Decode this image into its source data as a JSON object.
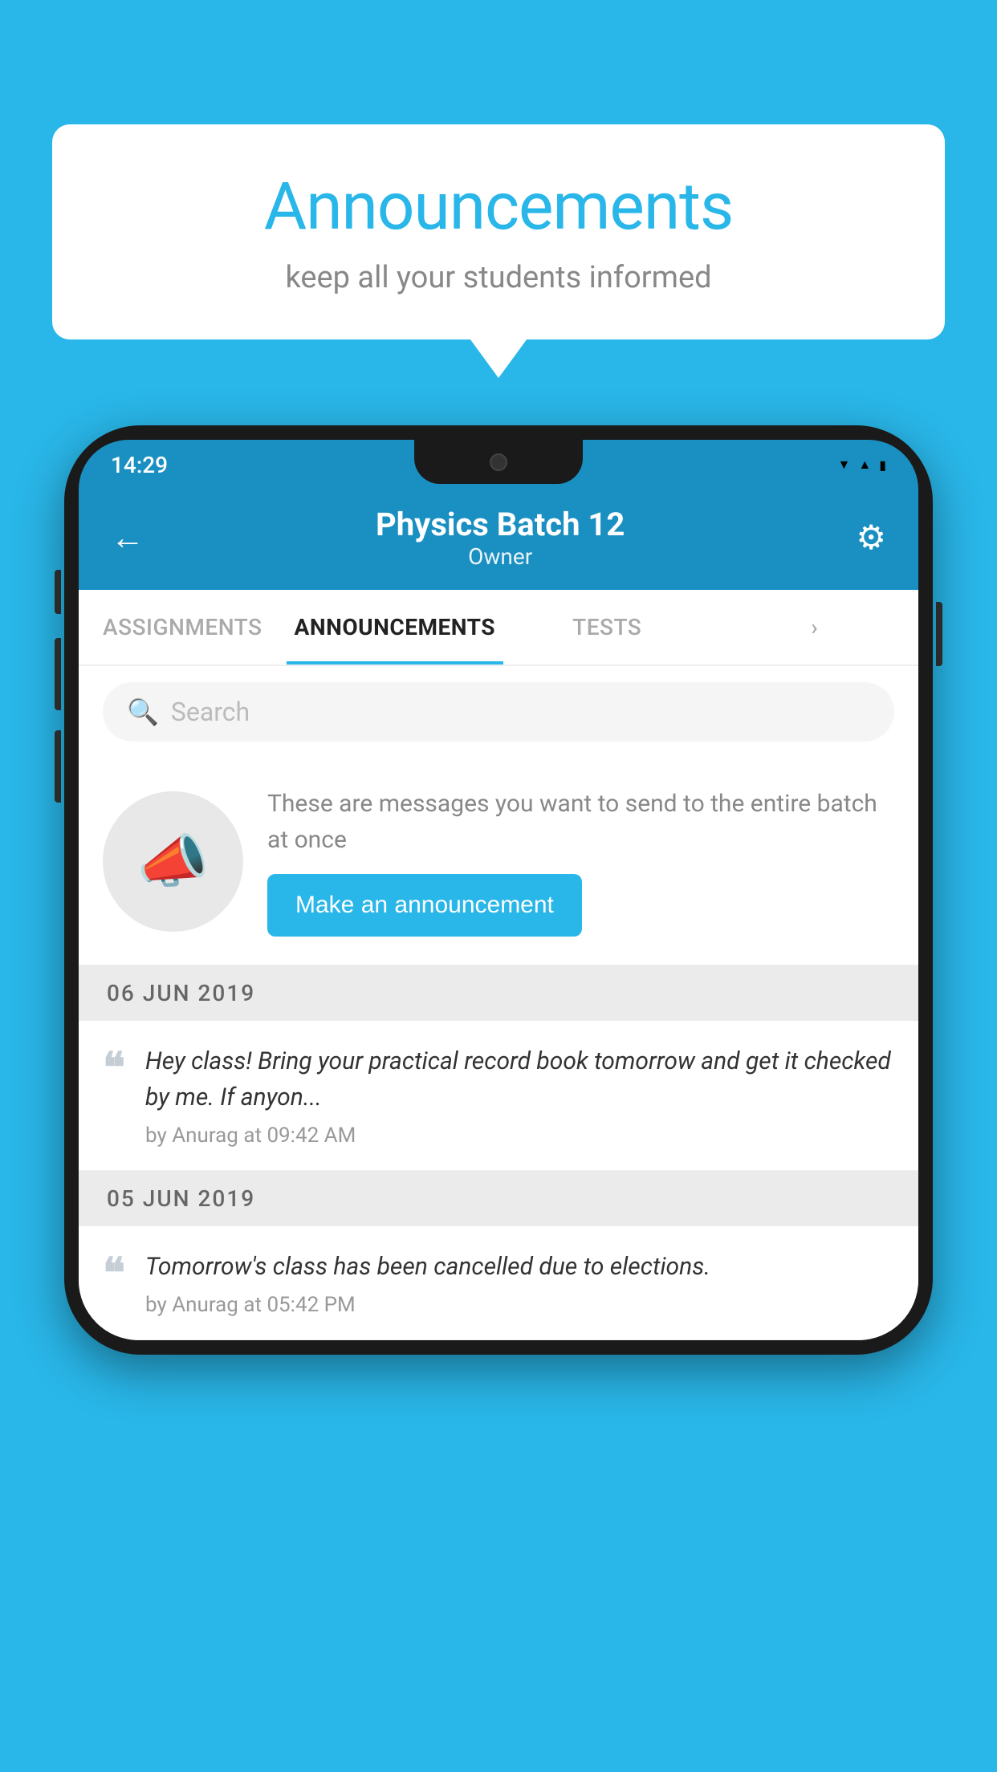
{
  "background_color": "#29b6e8",
  "speech_bubble": {
    "title": "Announcements",
    "subtitle": "keep all your students informed"
  },
  "status_bar": {
    "time": "14:29",
    "wifi": "▾",
    "signal": "▴",
    "battery": "▪"
  },
  "header": {
    "back_label": "←",
    "title": "Physics Batch 12",
    "subtitle": "Owner",
    "settings_icon": "⚙"
  },
  "tabs": [
    {
      "label": "ASSIGNMENTS",
      "active": false
    },
    {
      "label": "ANNOUNCEMENTS",
      "active": true
    },
    {
      "label": "TESTS",
      "active": false
    },
    {
      "label": "···",
      "active": false
    }
  ],
  "search": {
    "placeholder": "Search"
  },
  "promo": {
    "description": "These are messages you want to send to the entire batch at once",
    "button_label": "Make an announcement"
  },
  "announcements": [
    {
      "date": "06  JUN  2019",
      "text": "Hey class! Bring your practical record book tomorrow and get it checked by me. If anyon...",
      "meta": "by Anurag at 09:42 AM"
    },
    {
      "date": "05  JUN  2019",
      "text": "Tomorrow's class has been cancelled due to elections.",
      "meta": "by Anurag at 05:42 PM"
    }
  ]
}
